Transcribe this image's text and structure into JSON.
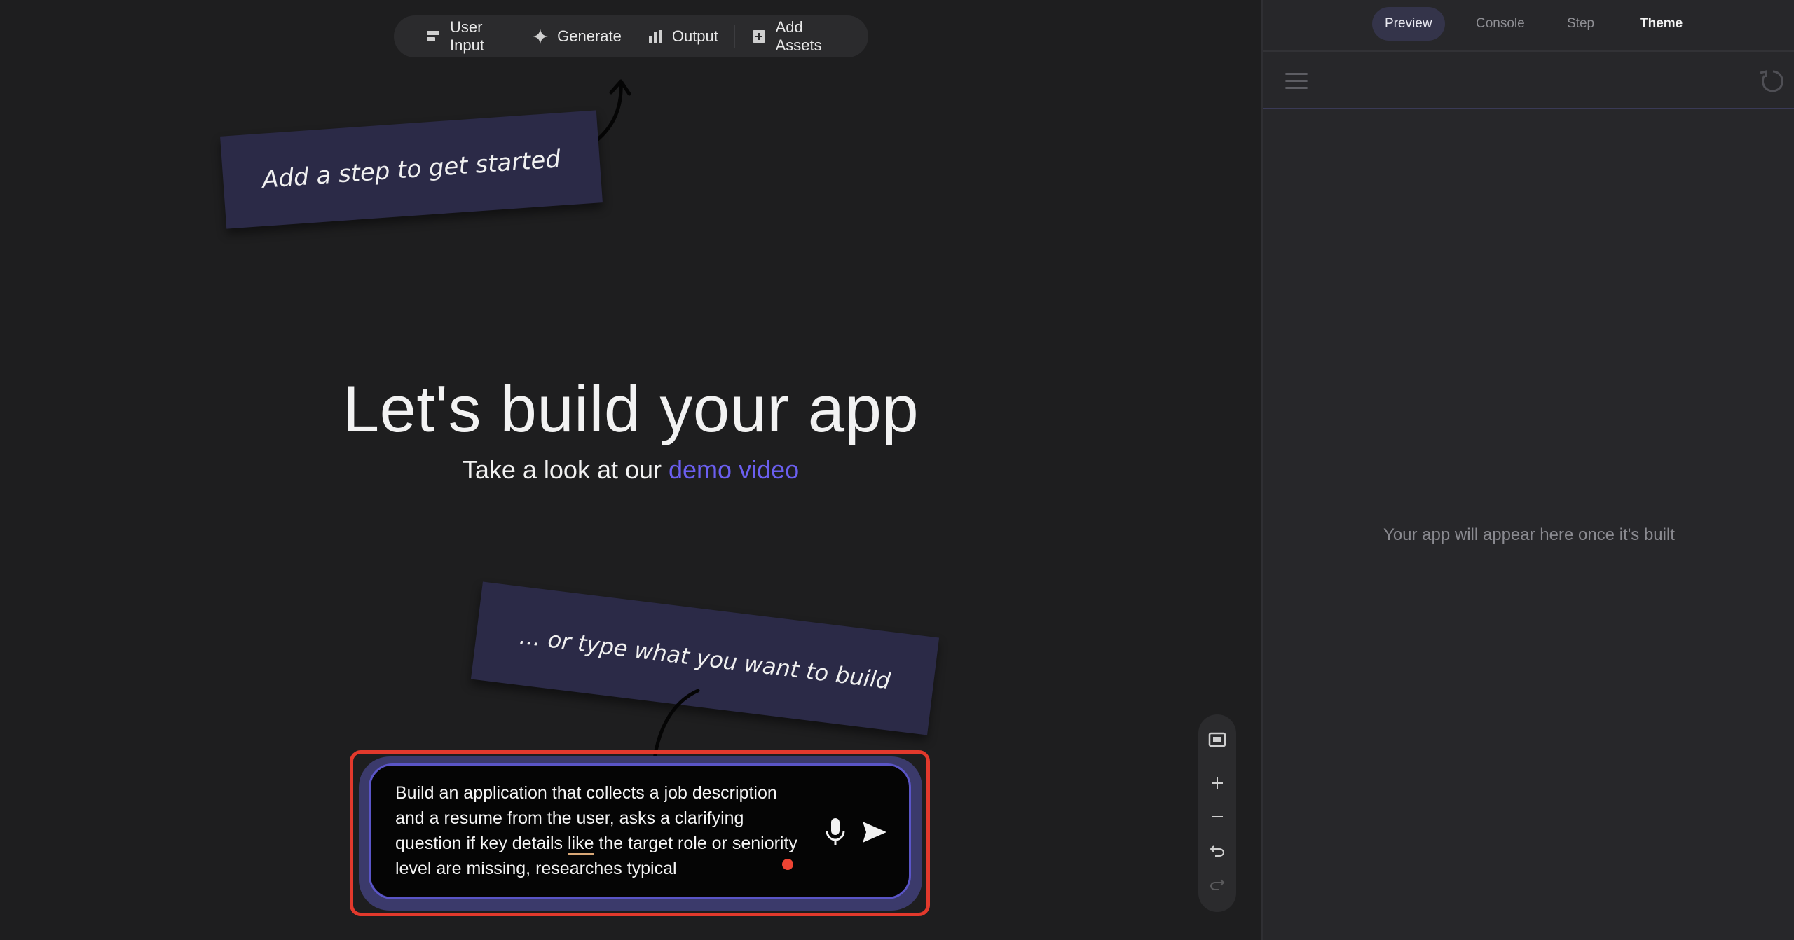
{
  "toolbar": {
    "items": [
      {
        "label": "User Input",
        "icon": "user-input-icon"
      },
      {
        "label": "Generate",
        "icon": "sparkle-icon"
      },
      {
        "label": "Output",
        "icon": "output-icon"
      },
      {
        "label": "Add Assets",
        "icon": "add-box-icon"
      }
    ]
  },
  "notes": {
    "top": "Add a step to get started",
    "bottom": "... or type what you want to build"
  },
  "hero": {
    "title": "Let's build your app",
    "subtitle_prefix": "Take a look at our ",
    "subtitle_link": "demo video"
  },
  "prompt": {
    "text_before": "Build an application that collects a job description and a resume from the user, asks a clarifying question if key details ",
    "text_underlined": "like",
    "text_after": " the target role or seniority level are missing, researches typical"
  },
  "zoom_controls": [
    "fit-view-icon",
    "zoom-in-icon",
    "zoom-out-icon",
    "undo-icon",
    "redo-icon"
  ],
  "right_panel": {
    "tabs": [
      "Preview",
      "Console",
      "Step",
      "Theme"
    ],
    "active_tab": "Preview",
    "empty_message": "Your app will appear here once it's built"
  },
  "colors": {
    "background": "#1e1e1f",
    "note_bg": "#2b2a47",
    "link": "#6b5ff0",
    "highlight_border": "#e2392c",
    "prompt_border": "#5a55c7"
  }
}
